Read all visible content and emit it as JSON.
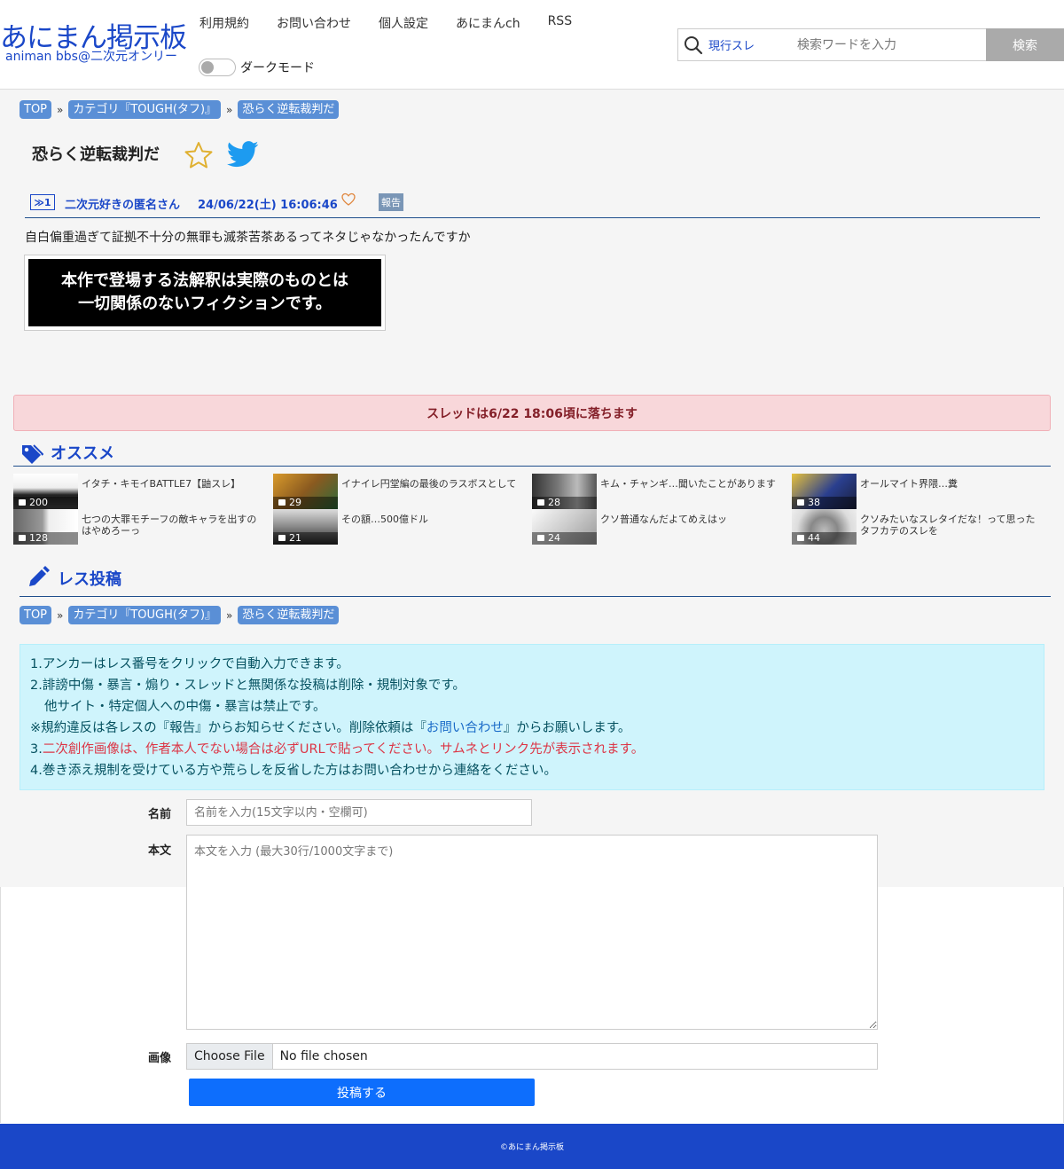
{
  "header": {
    "logo_title": "あにまん掲示板",
    "logo_sub": "animan bbs@二次元オンリー",
    "nav": [
      "利用規約",
      "お問い合わせ",
      "個人設定",
      "あにまんch",
      "RSS"
    ],
    "dark_mode_label": "ダークモード",
    "search_scope": "現行スレ",
    "search_placeholder": "検索ワードを入力",
    "search_button": "検索"
  },
  "breadcrumb": {
    "items": [
      "TOP",
      "カテゴリ『TOUGH(タフ)』",
      "恐らく逆転裁判だ"
    ],
    "separator": "»"
  },
  "thread": {
    "title": "恐らく逆転裁判だ"
  },
  "post": {
    "number": "≫1",
    "name": "二次元好きの匿名さん",
    "date": "24/06/22(土) 16:06:46",
    "report": "報告",
    "body": "自白偏重過ぎて証拠不十分の無罪も滅茶苦茶あるってネタじゃなかったんですか",
    "image_text_1": "本作で登場する法解釈は実際のものとは",
    "image_text_2": "一切関係のないフィクションです。"
  },
  "alert": "スレッドは6/22 18:06頃に落ちます",
  "recommend": {
    "title": "オススメ",
    "items": [
      {
        "text": "イタチ・キモイBATTLE7【鼬スレ】",
        "count": "200"
      },
      {
        "text": "イナイレ円堂編の最後のラスボスとして",
        "count": "29"
      },
      {
        "text": "キム・チャンギ…聞いたことがあります",
        "count": "28"
      },
      {
        "text": "オールマイト界隈…糞",
        "count": "38"
      },
      {
        "text": "七つの大罪モチーフの敵キャラを出すのはやめろーっ",
        "count": "128"
      },
      {
        "text": "その額…500億ドル",
        "count": "21"
      },
      {
        "text": "クソ普通なんだよてめえはッ",
        "count": "24"
      },
      {
        "text": "クソみたいなスレタイだな！って思ったタフカテのスレを",
        "count": "44"
      }
    ]
  },
  "reply": {
    "title": "レス投稿",
    "rules": {
      "line1": "1.アンカーはレス番号をクリックで自動入力できます。",
      "line2": "2.誹謗中傷・暴言・煽り・スレッドと無関係な投稿は削除・規制対象です。",
      "line3": "他サイト・特定個人への中傷・暴言は禁止です。",
      "line4_a": "※規約違反は各レスの『報告』からお知らせください。削除依頼は『",
      "line4_link": "お問い合わせ",
      "line4_b": "』からお願いします。",
      "line5_num": "3.",
      "line5_red": "二次創作画像は、作者本人でない場合は必ずURLで貼ってください。サムネとリンク先が表示されます。",
      "line6": "4.巻き添え規制を受けている方や荒らしを反省した方はお問い合わせから連絡をください。"
    },
    "name_label": "名前",
    "name_placeholder": "名前を入力(15文字以内・空欄可)",
    "body_label": "本文",
    "body_placeholder": "本文を入力 (最大30行/1000文字まで)",
    "image_label": "画像",
    "file_button": "Choose File",
    "file_status": "No file chosen",
    "submit": "投稿する"
  },
  "footer": "©あにまん掲示板",
  "colors": {
    "brand": "#1a47c8",
    "crumb": "#5a8fd6",
    "alert_bg": "#f8d7da",
    "info_bg": "#cff4fc",
    "submit": "#0d6efd"
  }
}
